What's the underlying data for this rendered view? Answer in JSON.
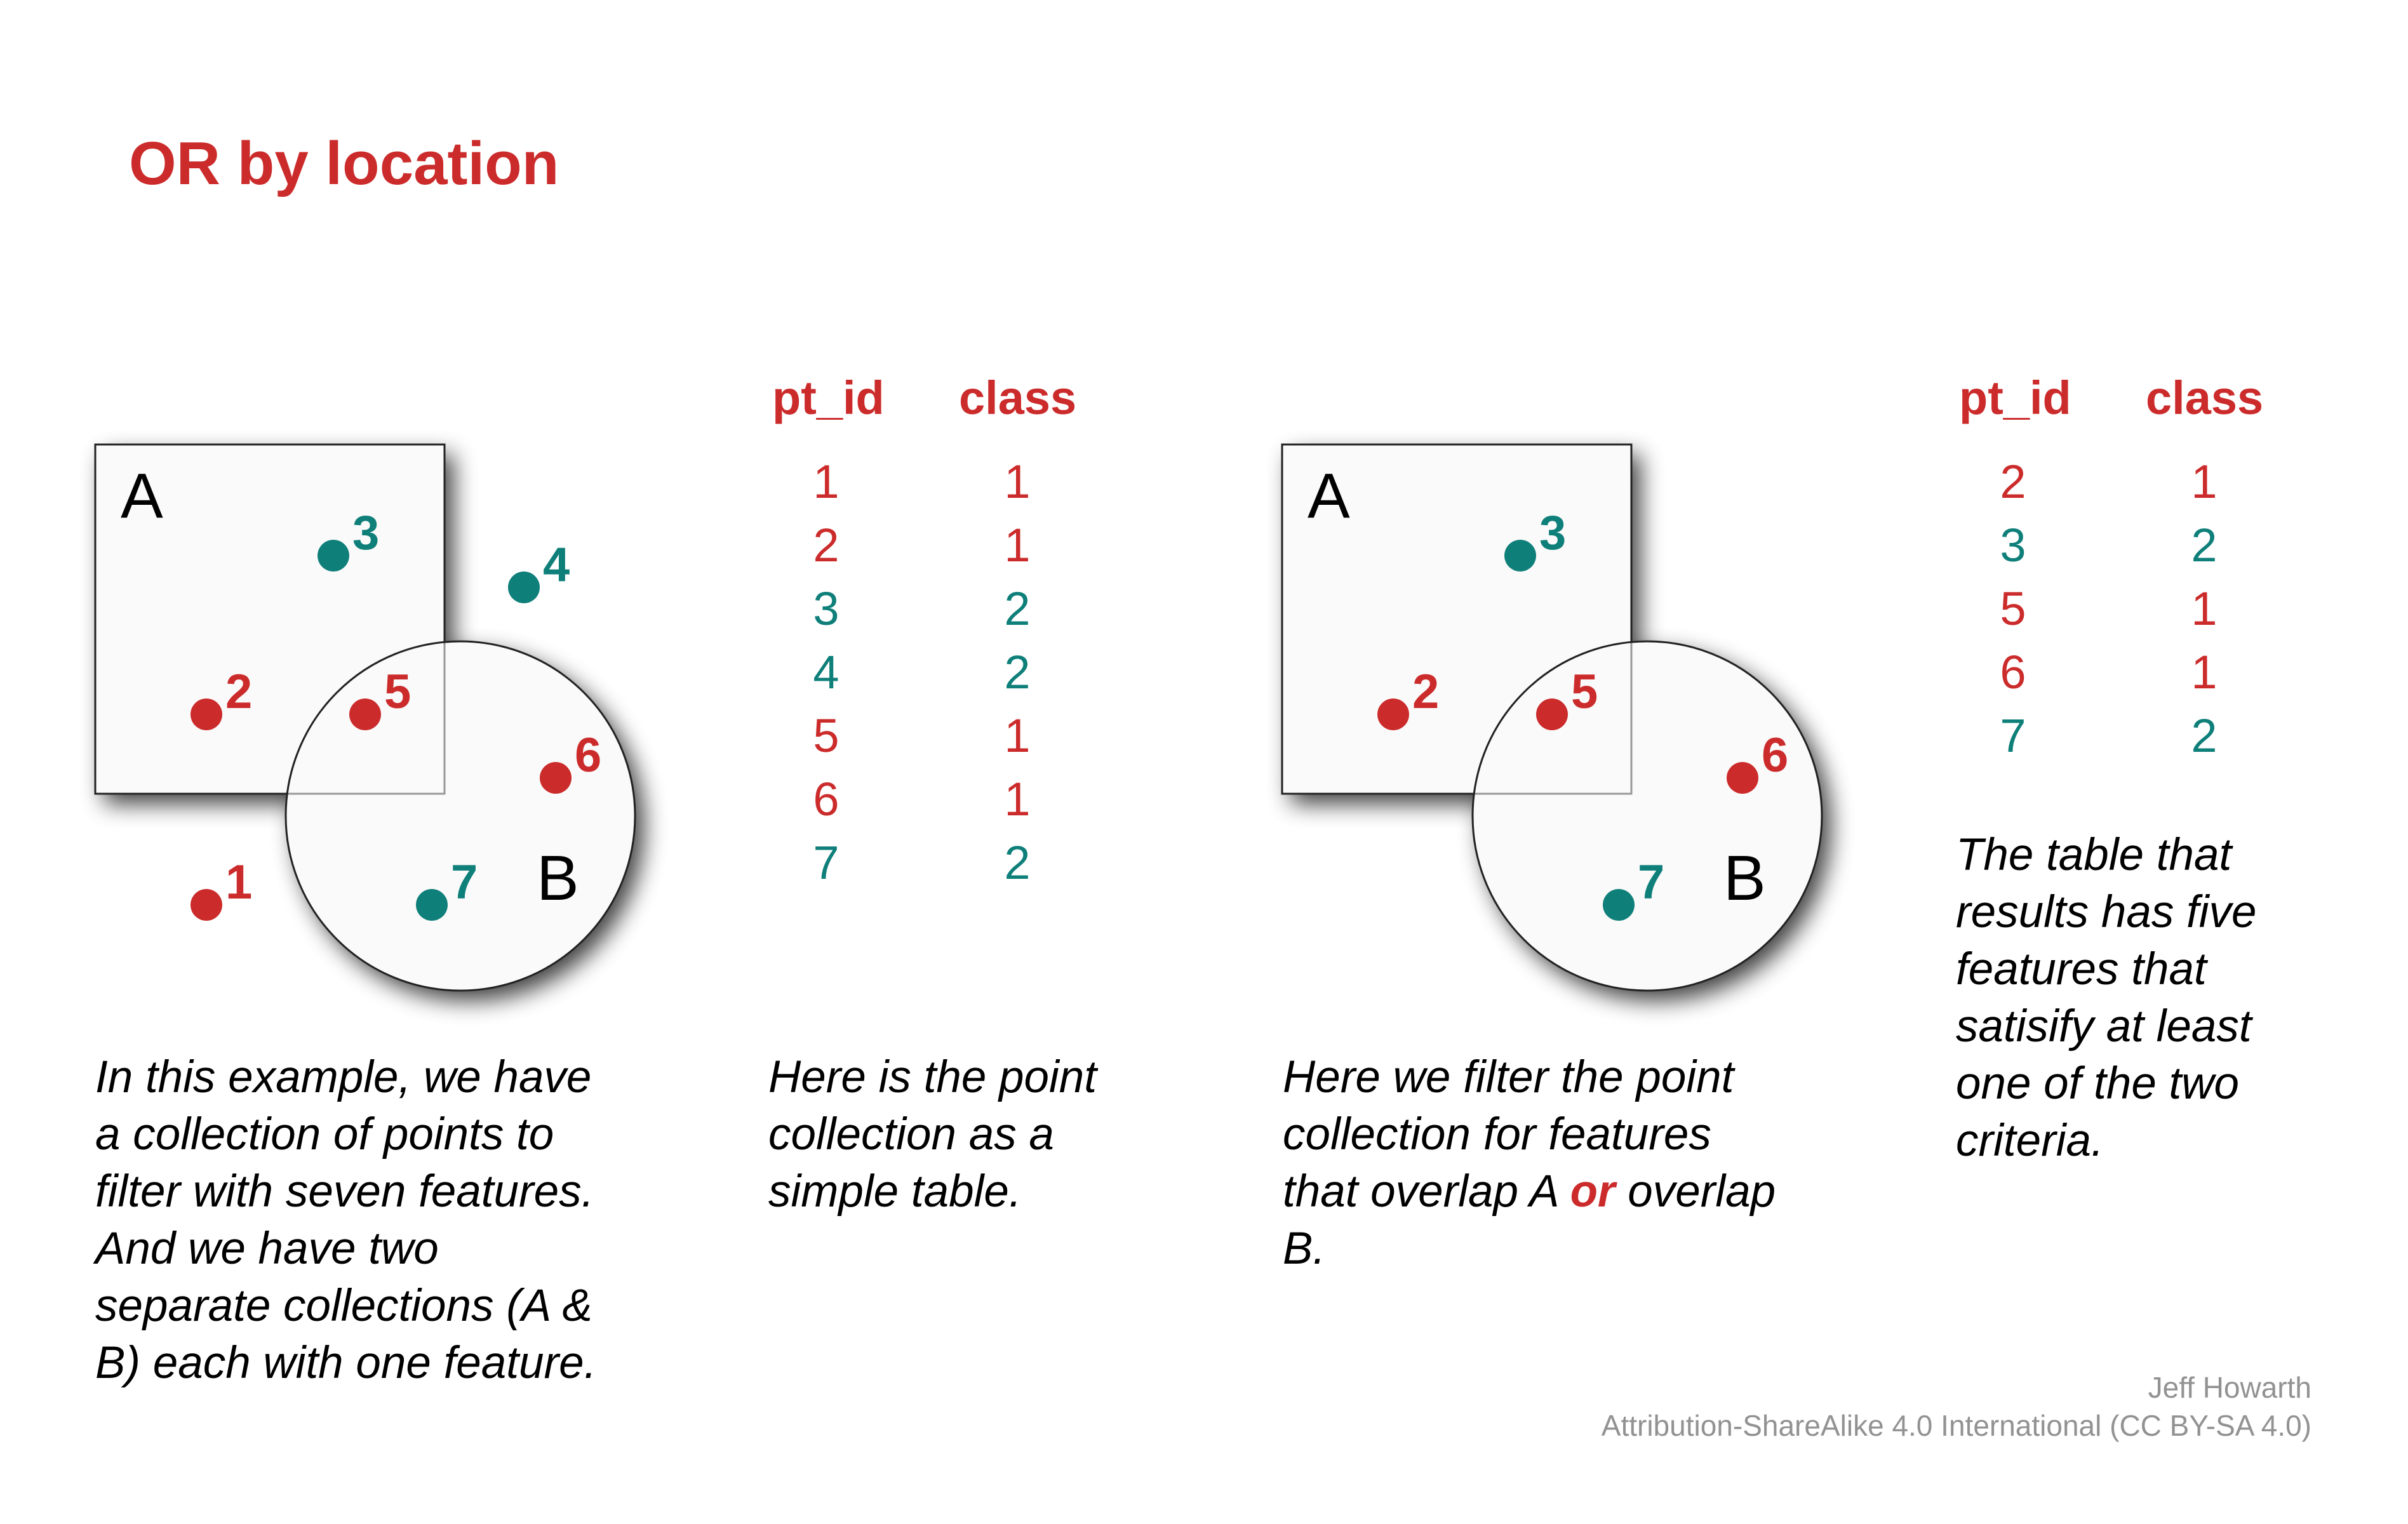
{
  "title": "OR by location",
  "colors": {
    "accent_red": "#cc2b2b",
    "class1_red": "#cc2b2b",
    "class2_teal": "#0f7f7a",
    "polygon_fill": "#fafafa",
    "polygon_stroke": "#222222",
    "footer_gray": "#929292"
  },
  "diagrams": [
    {
      "name": "all-points",
      "polygon_a_label": "A",
      "polygon_b_label": "B",
      "points": [
        {
          "id": "1",
          "class": 1,
          "label": "1"
        },
        {
          "id": "2",
          "class": 1,
          "label": "2"
        },
        {
          "id": "3",
          "class": 2,
          "label": "3"
        },
        {
          "id": "4",
          "class": 2,
          "label": "4"
        },
        {
          "id": "5",
          "class": 1,
          "label": "5"
        },
        {
          "id": "6",
          "class": 1,
          "label": "6"
        },
        {
          "id": "7",
          "class": 2,
          "label": "7"
        }
      ]
    },
    {
      "name": "filtered-points",
      "polygon_a_label": "A",
      "polygon_b_label": "B",
      "points": [
        {
          "id": "2",
          "class": 1,
          "label": "2"
        },
        {
          "id": "3",
          "class": 2,
          "label": "3"
        },
        {
          "id": "5",
          "class": 1,
          "label": "5"
        },
        {
          "id": "6",
          "class": 1,
          "label": "6"
        },
        {
          "id": "7",
          "class": 2,
          "label": "7"
        }
      ]
    }
  ],
  "tables": [
    {
      "headers": [
        "pt_id",
        "class"
      ],
      "rows": [
        {
          "pt_id": "1",
          "class": "1"
        },
        {
          "pt_id": "2",
          "class": "1"
        },
        {
          "pt_id": "3",
          "class": "2"
        },
        {
          "pt_id": "4",
          "class": "2"
        },
        {
          "pt_id": "5",
          "class": "1"
        },
        {
          "pt_id": "6",
          "class": "1"
        },
        {
          "pt_id": "7",
          "class": "2"
        }
      ]
    },
    {
      "headers": [
        "pt_id",
        "class"
      ],
      "rows": [
        {
          "pt_id": "2",
          "class": "1"
        },
        {
          "pt_id": "3",
          "class": "2"
        },
        {
          "pt_id": "5",
          "class": "1"
        },
        {
          "pt_id": "6",
          "class": "1"
        },
        {
          "pt_id": "7",
          "class": "2"
        }
      ]
    }
  ],
  "captions": {
    "intro": [
      "In this example, we have",
      "a collection of points to",
      "filter with seven features.",
      "And we have two",
      "separate collections (A &",
      "B) each with one feature."
    ],
    "table": [
      "Here is the point",
      "collection as a",
      "simple table."
    ],
    "filter": {
      "line1": "Here we filter the point",
      "line2": "collection for features",
      "line3_before": "that overlap A ",
      "line3_highlight": "or",
      "line3_after": " overlap",
      "line4": "B."
    },
    "result": [
      "The table that",
      "results has five",
      "features that",
      "satisify at least",
      "one of the two",
      "criteria."
    ]
  },
  "footer": {
    "author": "Jeff Howarth",
    "license": "Attribution-ShareAlike 4.0 International (CC BY-SA 4.0)"
  }
}
